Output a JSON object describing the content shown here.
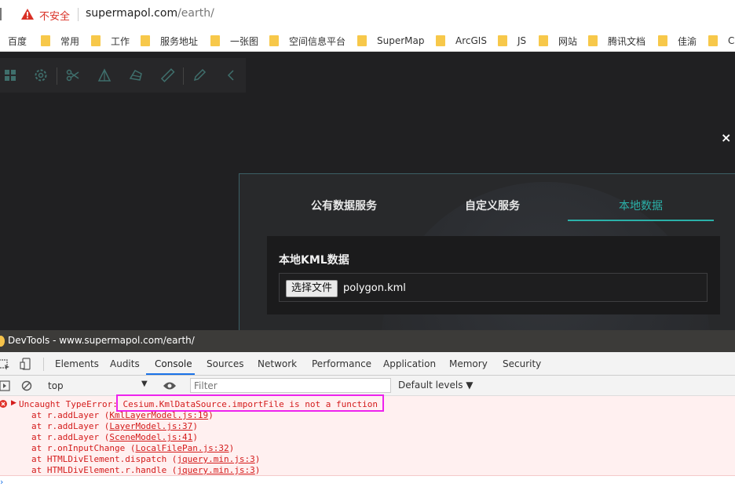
{
  "address_bar": {
    "security_label": "不安全",
    "url_host": "supermapol.com",
    "url_path": "/earth/"
  },
  "bookmarks": [
    "百度",
    "常用",
    "工作",
    "服务地址",
    "一张图",
    "空间信息平台",
    "SuperMap",
    "ArcGIS",
    "JS",
    "网站",
    "腾讯文档",
    "佳渝",
    "Ce"
  ],
  "toolbar_icons": [
    "grid-icon",
    "settings-icon",
    "scissors-icon",
    "terrain-icon",
    "layers-icon",
    "ruler-icon",
    "pencil-icon",
    "collapse-icon"
  ],
  "dialog": {
    "tabs": [
      "公有数据服务",
      "自定义服务",
      "本地数据"
    ],
    "active_tab": "本地数据",
    "panel_title": "本地KML数据",
    "file_button": "选择文件",
    "file_name": "polygon.kml",
    "close_label": "×"
  },
  "devtools": {
    "title": "DevTools - www.supermapol.com/earth/",
    "tabs": [
      "Elements",
      "Audits",
      "Console",
      "Sources",
      "Network",
      "Performance",
      "Application",
      "Memory",
      "Security"
    ],
    "active_tab": "Console",
    "context": "top",
    "filter_placeholder": "Filter",
    "levels": "Default levels ▼",
    "error": {
      "prefix": "Uncaught TypeError: ",
      "message": "Cesium.KmlDataSource.importFile is not a function",
      "stack": [
        {
          "text": "at r.addLayer (",
          "link": "KmlLayerModel.js:19",
          "end": ")"
        },
        {
          "text": "at r.addLayer (",
          "link": "LayerModel.js:37",
          "end": ")"
        },
        {
          "text": "at r.addLayer (",
          "link": "SceneModel.js:41",
          "end": ")"
        },
        {
          "text": "at r.onInputChange (",
          "link": "LocalFilePan.js:32",
          "end": ")"
        },
        {
          "text": "at HTMLDivElement.dispatch (",
          "link": "jquery.min.js:3",
          "end": ")"
        },
        {
          "text": "at HTMLDivElement.r.handle (",
          "link": "jquery.min.js:3",
          "end": ")"
        }
      ]
    }
  },
  "colors": {
    "accent": "#2bb1a9",
    "error": "#d41b1b",
    "highlight": "#ee22ee",
    "viewport_bg": "#202022"
  }
}
